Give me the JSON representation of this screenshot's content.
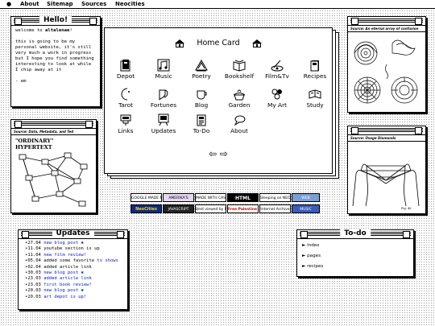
{
  "menubar": {
    "apple": "●",
    "items": [
      "About",
      "Sitemap",
      "Sources",
      "Neocities"
    ]
  },
  "hello": {
    "title": "Hello!",
    "welcome_prefix": "welcome to ",
    "site": "altalenae",
    "welcome_suffix": "!",
    "body": "this is going to be my personal website, it's still very much a work in progress but I hope you find something interesting to look at while I chip away at it",
    "sign": "- em"
  },
  "hypertext": {
    "caption": "Source: Data, Metadata, and Ted",
    "heading": "\"ORDINARY\" HYPERTEXT"
  },
  "home": {
    "title": "Home Card",
    "icons": [
      {
        "label": "Depot",
        "icon": "depot-icon"
      },
      {
        "label": "Music",
        "icon": "music-icon"
      },
      {
        "label": "Poetry",
        "icon": "poetry-icon"
      },
      {
        "label": "Bookshelf",
        "icon": "bookshelf-icon"
      },
      {
        "label": "Film&Tv",
        "icon": "film-icon"
      },
      {
        "label": "Recipes",
        "icon": "recipes-icon"
      },
      {
        "label": "Tarot",
        "icon": "tarot-icon"
      },
      {
        "label": "Fortunes",
        "icon": "fortunes-icon"
      },
      {
        "label": "Blog",
        "icon": "blog-icon"
      },
      {
        "label": "Garden",
        "icon": "garden-icon"
      },
      {
        "label": "My Art",
        "icon": "art-icon"
      },
      {
        "label": "Study",
        "icon": "study-icon"
      },
      {
        "label": "Links",
        "icon": "links-icon"
      },
      {
        "label": "Updates",
        "icon": "updates-icon"
      },
      {
        "label": "To-Do",
        "icon": "todo-icon"
      },
      {
        "label": "About",
        "icon": "about-icon"
      }
    ],
    "prev": "⇦",
    "next": "⇨"
  },
  "labyrinth": {
    "caption": "Source: An eternal array of confusion"
  },
  "cradle": {
    "caption": "Source: Osage Diamonds"
  },
  "badges": {
    "row1": [
      "GOOGLE MADE ME DO IT",
      "AMERIKA'S",
      "MADE WITH CASCADING STYLE SHEETS",
      "HTML",
      "Sleeping on NEOCITIES",
      "WEB"
    ],
    "row2": [
      "NeoCities",
      "JAVASCRIPT",
      "Best viewed by Friendly",
      "Free Palestine Now!!!",
      "Internet Archive",
      "MUSIC"
    ]
  },
  "updates": {
    "title": "Updates",
    "items": [
      {
        "date": "27.04",
        "text": "new blog post",
        "link": true,
        "star": true
      },
      {
        "date": "11.04",
        "text": "youtube section is up",
        "link": false
      },
      {
        "date": "11.04",
        "text": "new film review!",
        "link": true
      },
      {
        "date": "05.04",
        "text": "added some favorite ",
        "link": false,
        "tail": "tv shows"
      },
      {
        "date": "02.04",
        "text": "added article link",
        "link": false
      },
      {
        "date": "30.03",
        "text": "new blog post",
        "link": true,
        "star": true
      },
      {
        "date": "23.03",
        "text": "added article link",
        "link": true
      },
      {
        "date": "23.03",
        "text": "first book review!",
        "link": true
      },
      {
        "date": "20.03",
        "text": "new blog post",
        "link": true,
        "star": true
      },
      {
        "date": "20.03",
        "text": "art depot is up!",
        "link": true
      }
    ]
  },
  "todo": {
    "title": "To-do",
    "items": [
      "index",
      "pages",
      "recipes"
    ],
    "marker": "►"
  }
}
